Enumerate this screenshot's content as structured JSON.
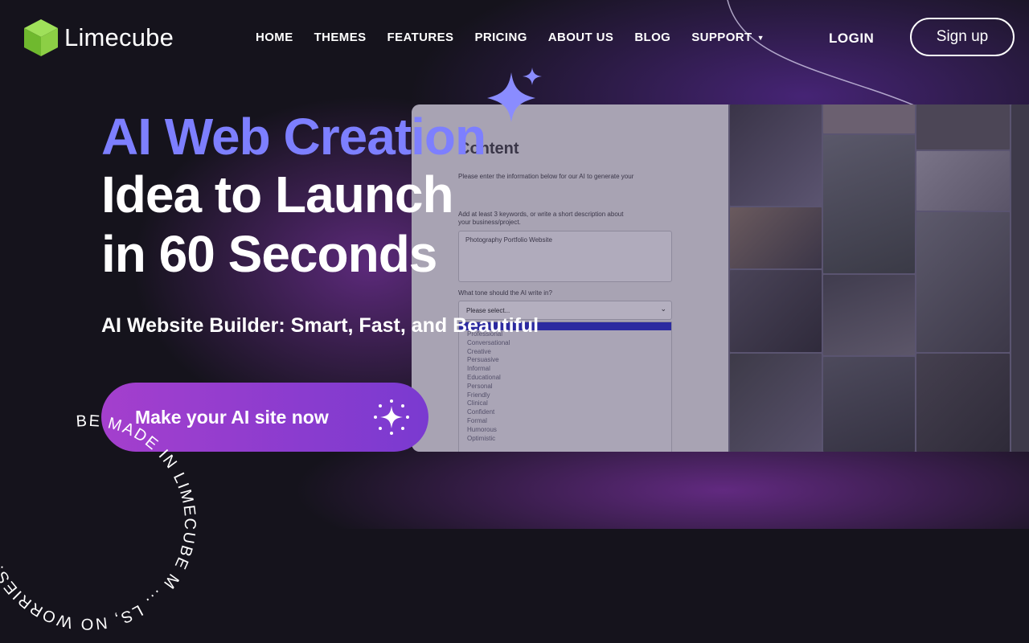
{
  "brand": {
    "name": "Limecube",
    "logo_color": "#7fca3c"
  },
  "nav": {
    "items": [
      "HOME",
      "THEMES",
      "FEATURES",
      "PRICING",
      "ABOUT US",
      "BLOG",
      "SUPPORT"
    ],
    "support_has_dropdown": true,
    "login": "LOGIN",
    "signup": "Sign up"
  },
  "hero": {
    "title_accent": "AI Web Creation",
    "title_line2": "Idea to Launch",
    "title_line3": "in 60 Seconds",
    "subtitle": "AI Website Builder: Smart, Fast, and Beautiful",
    "cta": "Make your AI site now",
    "accent_color": "#7d7fff"
  },
  "badge": {
    "text": "BE  MADE IN LIMECUBE  M ... LS, NO WORRIES!"
  },
  "mockup": {
    "form_title": "Content",
    "intro": "Please enter the information below for our AI to generate your",
    "keywords_label_1": "Add at least 3 keywords, or write a short description about",
    "keywords_label_2": "your business/project.",
    "keywords_value": "Photography Portfolio Website",
    "tone_label": "What tone should the AI write in?",
    "tone_select": "Please select...",
    "tone_options": [
      "Professional",
      "Conversational",
      "Creative",
      "Persuasive",
      "Informal",
      "Educational",
      "Personal",
      "Friendly",
      "Clinical",
      "Confident",
      "Formal",
      "Humorous",
      "Optimistic"
    ]
  }
}
